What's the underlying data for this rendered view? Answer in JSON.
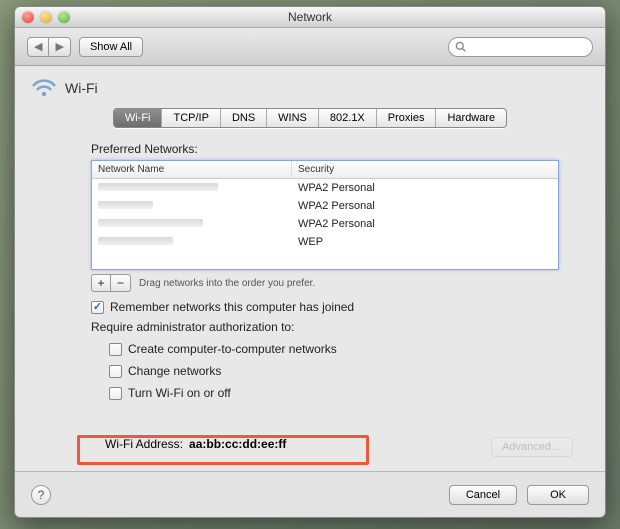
{
  "window": {
    "title": "Network"
  },
  "toolbar": {
    "show_all": "Show All",
    "search_placeholder": ""
  },
  "panel": {
    "title": "Wi-Fi"
  },
  "tabs": [
    {
      "label": "Wi-Fi",
      "active": true
    },
    {
      "label": "TCP/IP",
      "active": false
    },
    {
      "label": "DNS",
      "active": false
    },
    {
      "label": "WINS",
      "active": false
    },
    {
      "label": "802.1X",
      "active": false
    },
    {
      "label": "Proxies",
      "active": false
    },
    {
      "label": "Hardware",
      "active": false
    }
  ],
  "preferred": {
    "label": "Preferred Networks:",
    "columns": {
      "name": "Network Name",
      "security": "Security"
    },
    "rows": [
      {
        "security": "WPA2 Personal"
      },
      {
        "security": "WPA2 Personal"
      },
      {
        "security": "WPA2 Personal"
      },
      {
        "security": "WEP"
      }
    ],
    "hint": "Drag networks into the order you prefer."
  },
  "remember": {
    "label": "Remember networks this computer has joined",
    "checked": true
  },
  "require_admin": {
    "label": "Require administrator authorization to:",
    "items": [
      {
        "label": "Create computer-to-computer networks",
        "checked": false
      },
      {
        "label": "Change networks",
        "checked": false
      },
      {
        "label": "Turn Wi-Fi on or off",
        "checked": false
      }
    ]
  },
  "wifi_address": {
    "label": "Wi-Fi Address:",
    "value": "aa:bb:cc:dd:ee:ff"
  },
  "buttons": {
    "advanced": "Advanced…",
    "cancel": "Cancel",
    "ok": "OK"
  }
}
